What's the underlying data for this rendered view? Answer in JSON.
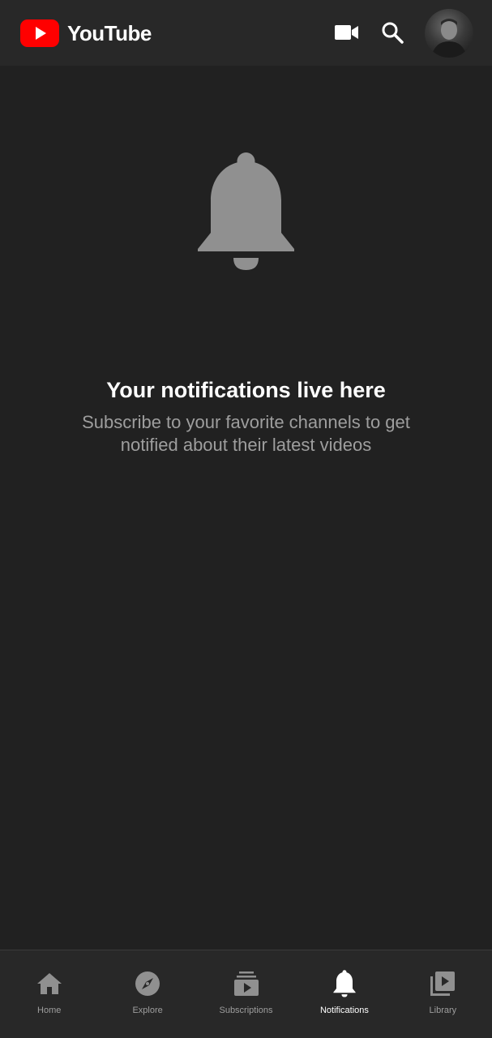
{
  "header": {
    "brand": "YouTube",
    "icons": [
      "youtube-logo-icon",
      "video-camera-icon",
      "search-icon",
      "avatar"
    ]
  },
  "empty_state": {
    "icon": "bell-icon",
    "title": "Your notifications live here",
    "subtitle": "Subscribe to your favorite channels to get notified about their latest videos"
  },
  "bottom_nav": {
    "active": "Notifications",
    "items": [
      {
        "label": "Home",
        "icon": "home-icon"
      },
      {
        "label": "Explore",
        "icon": "compass-icon"
      },
      {
        "label": "Subscriptions",
        "icon": "subscriptions-icon"
      },
      {
        "label": "Notifications",
        "icon": "bell-icon"
      },
      {
        "label": "Library",
        "icon": "library-icon"
      }
    ]
  },
  "colors": {
    "background": "#212121",
    "bar": "#282828",
    "brand_red": "#ff0000",
    "muted": "#9e9e9e",
    "icon_gray": "#909090",
    "active": "#ffffff"
  }
}
